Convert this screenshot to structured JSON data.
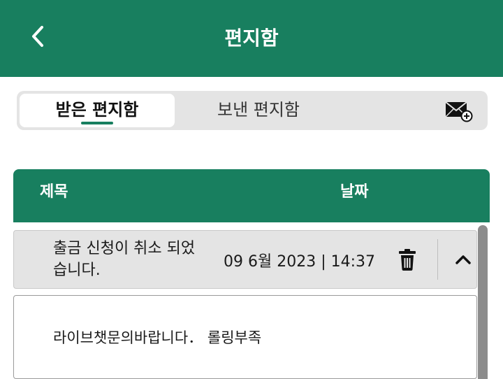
{
  "header": {
    "title": "편지함",
    "back_icon": "chevron-left-icon"
  },
  "tabs": [
    {
      "label": "받은 편지함",
      "active": true
    },
    {
      "label": "보낸 편지함",
      "active": false
    }
  ],
  "compose_icon": "mail-plus-icon",
  "table": {
    "columns": {
      "subject": "제목",
      "date": "날짜"
    },
    "rows": [
      {
        "subject": "출금 신청이 취소 되었습니다.",
        "date": "09 6월 2023 | 14:37",
        "expanded": true,
        "body": "라이브챗문의바랍니다． 롤링부족"
      }
    ]
  },
  "colors": {
    "brand": "#187f5f",
    "tab_bg": "#e4e4e4",
    "row_bg": "#e4e4e4",
    "scrollbar": "#8c8c8c"
  }
}
